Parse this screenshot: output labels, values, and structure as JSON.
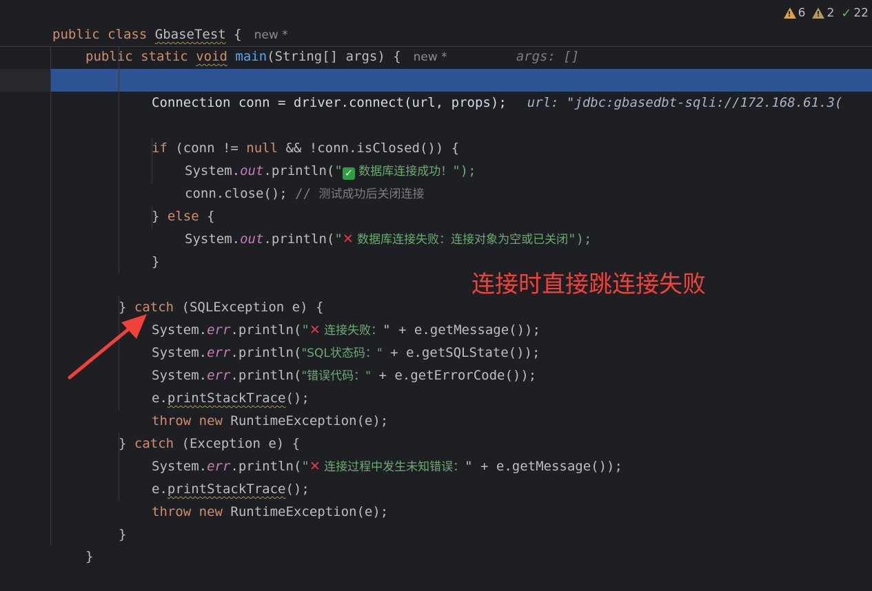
{
  "sticky": {
    "line1": {
      "kw1": "public",
      "kw2": "class",
      "class_name": "GbaseTest",
      "brace": "{",
      "inlay": "new *"
    },
    "line2": {
      "kw1": "public",
      "kw2": "static",
      "kw3": "void",
      "method": "main",
      "params": "(String[] args) {",
      "inlay": "new *",
      "hint": "args: []"
    }
  },
  "status": {
    "warnings": "6",
    "weak_warnings": "2",
    "ok": "22"
  },
  "code": {
    "l_conn": {
      "text": "Connection conn = driver.connect(url, props);",
      "hint": "url: \"jdbc:gbasedbt-sqli://172.168.61.3("
    },
    "l_if": {
      "kw": "if",
      "rest1": " (conn != ",
      "kw_null": "null",
      "rest2": " && !conn.isClosed()) {"
    },
    "l_print_ok": {
      "pre": "System.",
      "field": "out",
      "mid": ".println(",
      "q": "\"",
      "emoji": "✓",
      "msg": " 数据库连接成功！",
      "end": "\");"
    },
    "l_close": {
      "code": "conn.close(); ",
      "comment": "// ",
      "comment_text": "测试成功后关闭连接"
    },
    "l_else": {
      "pre": "} ",
      "kw": "else",
      "post": " {"
    },
    "l_print_fail": {
      "pre": "System.",
      "field": "out",
      "mid": ".println(",
      "q": "\"",
      "emoji": "✕",
      "msg": " 数据库连接失败：连接对象为空或已关闭",
      "end": "\");"
    },
    "l_close_brace": "}",
    "l_catch1": {
      "pre": "} ",
      "kw": "catch",
      "post": " (SQLException e) {"
    },
    "l_err1": {
      "pre": "System.",
      "field": "err",
      "mid": ".println(",
      "q": "\"",
      "emoji": "✕",
      "msg": " 连接失败：",
      "end": "\" + e.getMessage());"
    },
    "l_err2": {
      "pre": "System.",
      "field": "err",
      "mid": ".println(",
      "str": "\"SQL状态码：\"",
      "end": " + e.getSQLState());"
    },
    "l_err3": {
      "pre": "System.",
      "field": "err",
      "mid": ".println(",
      "str": "\"错误代码：\"",
      "end": " + e.getErrorCode());"
    },
    "l_trace1": {
      "pre": "e.",
      "method": "printStackTrace",
      "end": "();"
    },
    "l_throw1": {
      "kw1": "throw",
      "kw2": "new",
      "rest": " RuntimeException(e);"
    },
    "l_catch2": {
      "pre": "} ",
      "kw": "catch",
      "post": " (Exception e) {"
    },
    "l_err4": {
      "pre": "System.",
      "field": "err",
      "mid": ".println(",
      "q": "\"",
      "emoji": "✕",
      "msg": " 连接过程中发生未知错误：",
      "end": "\" + e.getMessage());"
    },
    "l_trace2": {
      "pre": "e.",
      "method": "printStackTrace",
      "end": "();"
    },
    "l_throw2": {
      "kw1": "throw",
      "kw2": "new",
      "rest": " RuntimeException(e);"
    },
    "l_close2": "}",
    "l_close3": "}"
  },
  "annotation": {
    "text": "连接时直接跳连接失败",
    "color": "#f0413a"
  }
}
